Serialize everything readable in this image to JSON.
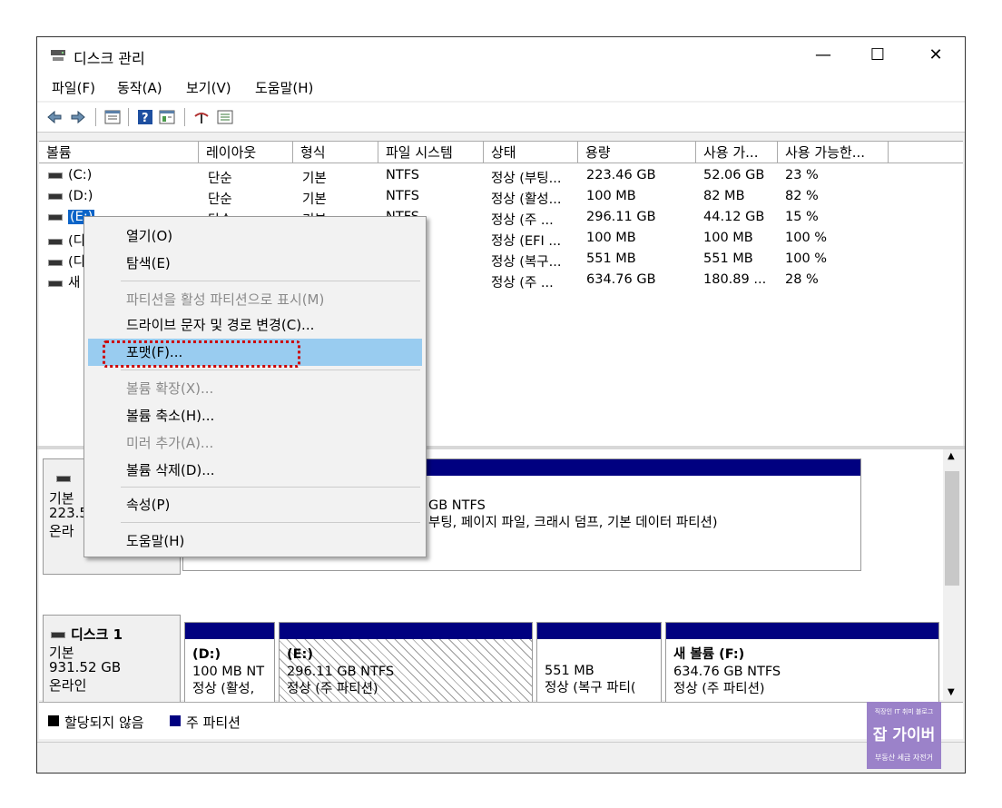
{
  "window": {
    "title": "디스크 관리",
    "controls": {
      "minimize": "—",
      "maximize": "☐",
      "close": "✕"
    }
  },
  "menubar": [
    "파일(F)",
    "동작(A)",
    "보기(V)",
    "도움말(H)"
  ],
  "toolbar_icons": [
    "back-arrow-icon",
    "forward-arrow-icon",
    "list-view-icon",
    "help-icon",
    "details-view-icon",
    "connect-icon",
    "properties-icon"
  ],
  "volume_list": {
    "columns": [
      "볼륨",
      "레이아웃",
      "형식",
      "파일 시스템",
      "상태",
      "용량",
      "사용 가...",
      "사용 가능한..."
    ],
    "rows": [
      {
        "volume": "(C:)",
        "layout": "단순",
        "type": "기본",
        "fs": "NTFS",
        "status": "정상 (부팅...",
        "capacity": "223.46 GB",
        "free": "52.06 GB",
        "pct": "23 %"
      },
      {
        "volume": "(D:)",
        "layout": "단순",
        "type": "기본",
        "fs": "NTFS",
        "status": "정상 (활성...",
        "capacity": "100 MB",
        "free": "82 MB",
        "pct": "82 %"
      },
      {
        "volume": "(E:)",
        "layout": "단순",
        "type": "기본",
        "fs": "NTFS",
        "status": "정상 (주 ...",
        "capacity": "296.11 GB",
        "free": "44.12 GB",
        "pct": "15 %"
      },
      {
        "volume": "(디",
        "layout": "",
        "type": "",
        "fs": "",
        "status": "정상 (EFI ...",
        "capacity": "100 MB",
        "free": "100 MB",
        "pct": "100 %"
      },
      {
        "volume": "(디",
        "layout": "",
        "type": "",
        "fs": "",
        "status": "정상 (복구...",
        "capacity": "551 MB",
        "free": "551 MB",
        "pct": "100 %"
      },
      {
        "volume": "새",
        "layout": "",
        "type": "",
        "fs": "",
        "status": "정상 (주 ...",
        "capacity": "634.76 GB",
        "free": "180.89 ...",
        "pct": "28 %"
      }
    ]
  },
  "context_menu": {
    "items": [
      {
        "label": "열기(O)",
        "enabled": true
      },
      {
        "label": "탐색(E)",
        "enabled": true
      },
      {
        "label": "파티션을 활성 파티션으로 표시(M)",
        "enabled": false
      },
      {
        "label": "드라이브 문자 및 경로 변경(C)...",
        "enabled": true
      },
      {
        "label": "포맷(F)...",
        "enabled": true,
        "highlighted": true
      },
      {
        "label": "볼륨 확장(X)...",
        "enabled": false
      },
      {
        "label": "볼륨 축소(H)...",
        "enabled": true
      },
      {
        "label": "미러 추가(A)...",
        "enabled": false
      },
      {
        "label": "볼륨 삭제(D)...",
        "enabled": true
      },
      {
        "label": "속성(P)",
        "enabled": true
      },
      {
        "label": "도움말(H)",
        "enabled": true
      }
    ]
  },
  "disk0": {
    "label_partial": "▬  ",
    "type_partial": "기본",
    "size_partial": "223.5",
    "status_partial": "온라",
    "partition_line1": "GB NTFS",
    "partition_line2": "부팅, 페이지 파일, 크래시 덤프, 기본 데이터 파티션)"
  },
  "disk1": {
    "name": "디스크 1",
    "type": "기본",
    "size": "931.52 GB",
    "status": "온라인",
    "partitions": [
      {
        "name": "(D:)",
        "size": "100 MB NT",
        "status": "정상 (활성,"
      },
      {
        "name": "(E:)",
        "size": "296.11 GB NTFS",
        "status": "정상 (주 파티션)"
      },
      {
        "name": "",
        "size": "551 MB",
        "status": "정상 (복구 파티("
      },
      {
        "name": "새 볼륨  (F:)",
        "size": "634.76 GB NTFS",
        "status": "정상 (주 파티션)"
      }
    ]
  },
  "legend": {
    "unallocated": "할당되지 않음",
    "primary": "주 파티션"
  },
  "watermark": {
    "top": "직장인 IT 취미 블로그",
    "logo": "잡 가이버",
    "bottom": "부동산 세금 자전거"
  },
  "colors": {
    "partition_bar": "#000080",
    "highlight": "#99ccf0",
    "focus_box": "#cc0000",
    "logo_bg": "#9b82c9"
  }
}
